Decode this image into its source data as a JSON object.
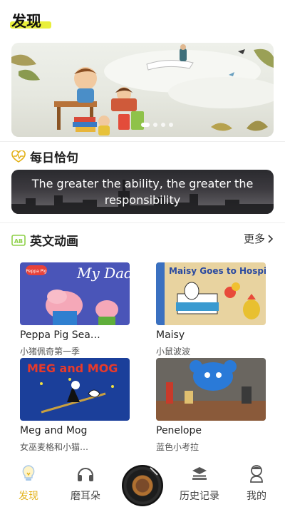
{
  "header": {
    "title": "发现"
  },
  "banner": {
    "slides": 4,
    "active_slide": 1
  },
  "daily": {
    "title": "每日恰句",
    "quote": "The greater the ability, the greater the responsibility"
  },
  "cartoons": {
    "title": "英文动画",
    "more": "更多",
    "items": [
      {
        "title": "Peppa Pig Sea…",
        "subtitle": "小猪佩奇第一季",
        "cover_text": "My Daddy",
        "badge": "Peppa Pig"
      },
      {
        "title": "Maisy",
        "subtitle": "小鼠波波",
        "cover_text": "Maisy Goes to Hospital"
      },
      {
        "title": "Meg and Mog",
        "subtitle": "女巫麦格和小猫…",
        "cover_text": "MEG and MOG"
      },
      {
        "title": "Penelope",
        "subtitle": "蓝色小考拉"
      }
    ]
  },
  "tabbar": {
    "items": [
      {
        "label": "发现",
        "icon": "bulb-icon",
        "active": true
      },
      {
        "label": "磨耳朵",
        "icon": "headphones-icon",
        "active": false
      },
      {
        "label": "",
        "icon": "record-disc-icon",
        "active": false
      },
      {
        "label": "历史记录",
        "icon": "books-icon",
        "active": false
      },
      {
        "label": "我的",
        "icon": "user-icon",
        "active": false
      }
    ]
  },
  "colors": {
    "accent": "#e3b21a",
    "title_highlight": "#e9ef3b",
    "section_icon": "#8fd14a"
  }
}
